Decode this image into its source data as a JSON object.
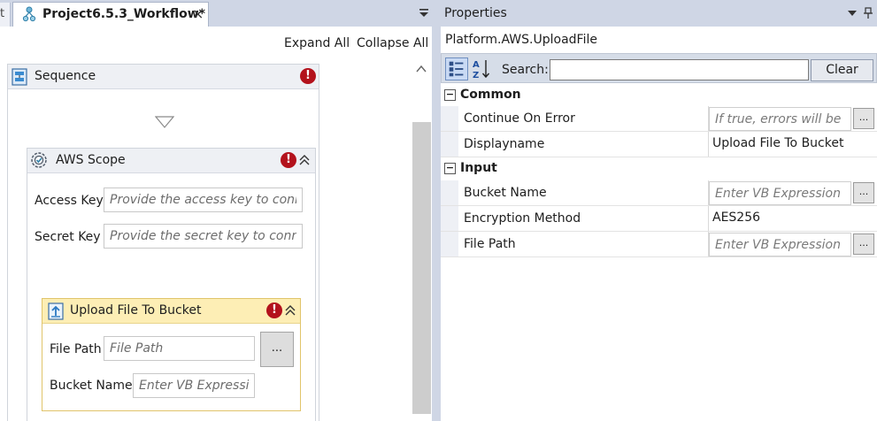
{
  "designer": {
    "prev_tab_fragment": "t",
    "tab_title": "Project6.5.3_Workflow*",
    "tab_close": "×",
    "expand_all": "Expand All",
    "collapse_all": "Collapse All",
    "sequence": {
      "title": "Sequence",
      "error_mark": "!"
    },
    "aws_scope": {
      "title": "AWS Scope",
      "error_mark": "!",
      "access_key_label": "Access Key",
      "access_key_placeholder": "Provide the access key to connect",
      "secret_key_label": "Secret Key",
      "secret_key_placeholder": "Provide the secret key to connect"
    },
    "upload": {
      "title": "Upload File To Bucket",
      "error_mark": "!",
      "file_path_label": "File Path",
      "file_path_placeholder": "File Path",
      "browse_label": "...",
      "bucket_name_label": "Bucket Name",
      "bucket_name_placeholder": "Enter VB Expression"
    }
  },
  "properties": {
    "title": "Properties",
    "activity_type": "Platform.AWS.UploadFile",
    "search_label": "Search:",
    "search_value": "",
    "clear_label": "Clear",
    "categories": [
      {
        "toggle": "−",
        "name": "Common",
        "rows": [
          {
            "name": "Continue On Error",
            "placeholder": "If true, errors will be ignored",
            "value": "",
            "button": "..."
          },
          {
            "name": "Displayname",
            "value": "Upload File To Bucket"
          }
        ]
      },
      {
        "toggle": "−",
        "name": "Input",
        "rows": [
          {
            "name": "Bucket Name",
            "placeholder": "Enter VB Expression",
            "value": "",
            "button": "..."
          },
          {
            "name": "Encryption Method",
            "value": "AES256"
          },
          {
            "name": "File Path",
            "placeholder": "Enter VB Expression",
            "value": "",
            "button": "..."
          }
        ]
      }
    ]
  },
  "colors": {
    "panel_chrome": "#cfd6e5",
    "upload_header": "#fdeeb5",
    "error_badge": "#b3121c",
    "activity_header": "#eef0f4"
  },
  "icons": [
    "workflow-icon",
    "close-icon",
    "dropdown-arrow-icon",
    "sequence-icon",
    "error-icon",
    "drop-target-arrow-icon",
    "gear-icon",
    "collapse-chevron-icon",
    "upload-icon",
    "pin-icon",
    "categorized-view-icon",
    "alphabetical-sort-icon"
  ]
}
